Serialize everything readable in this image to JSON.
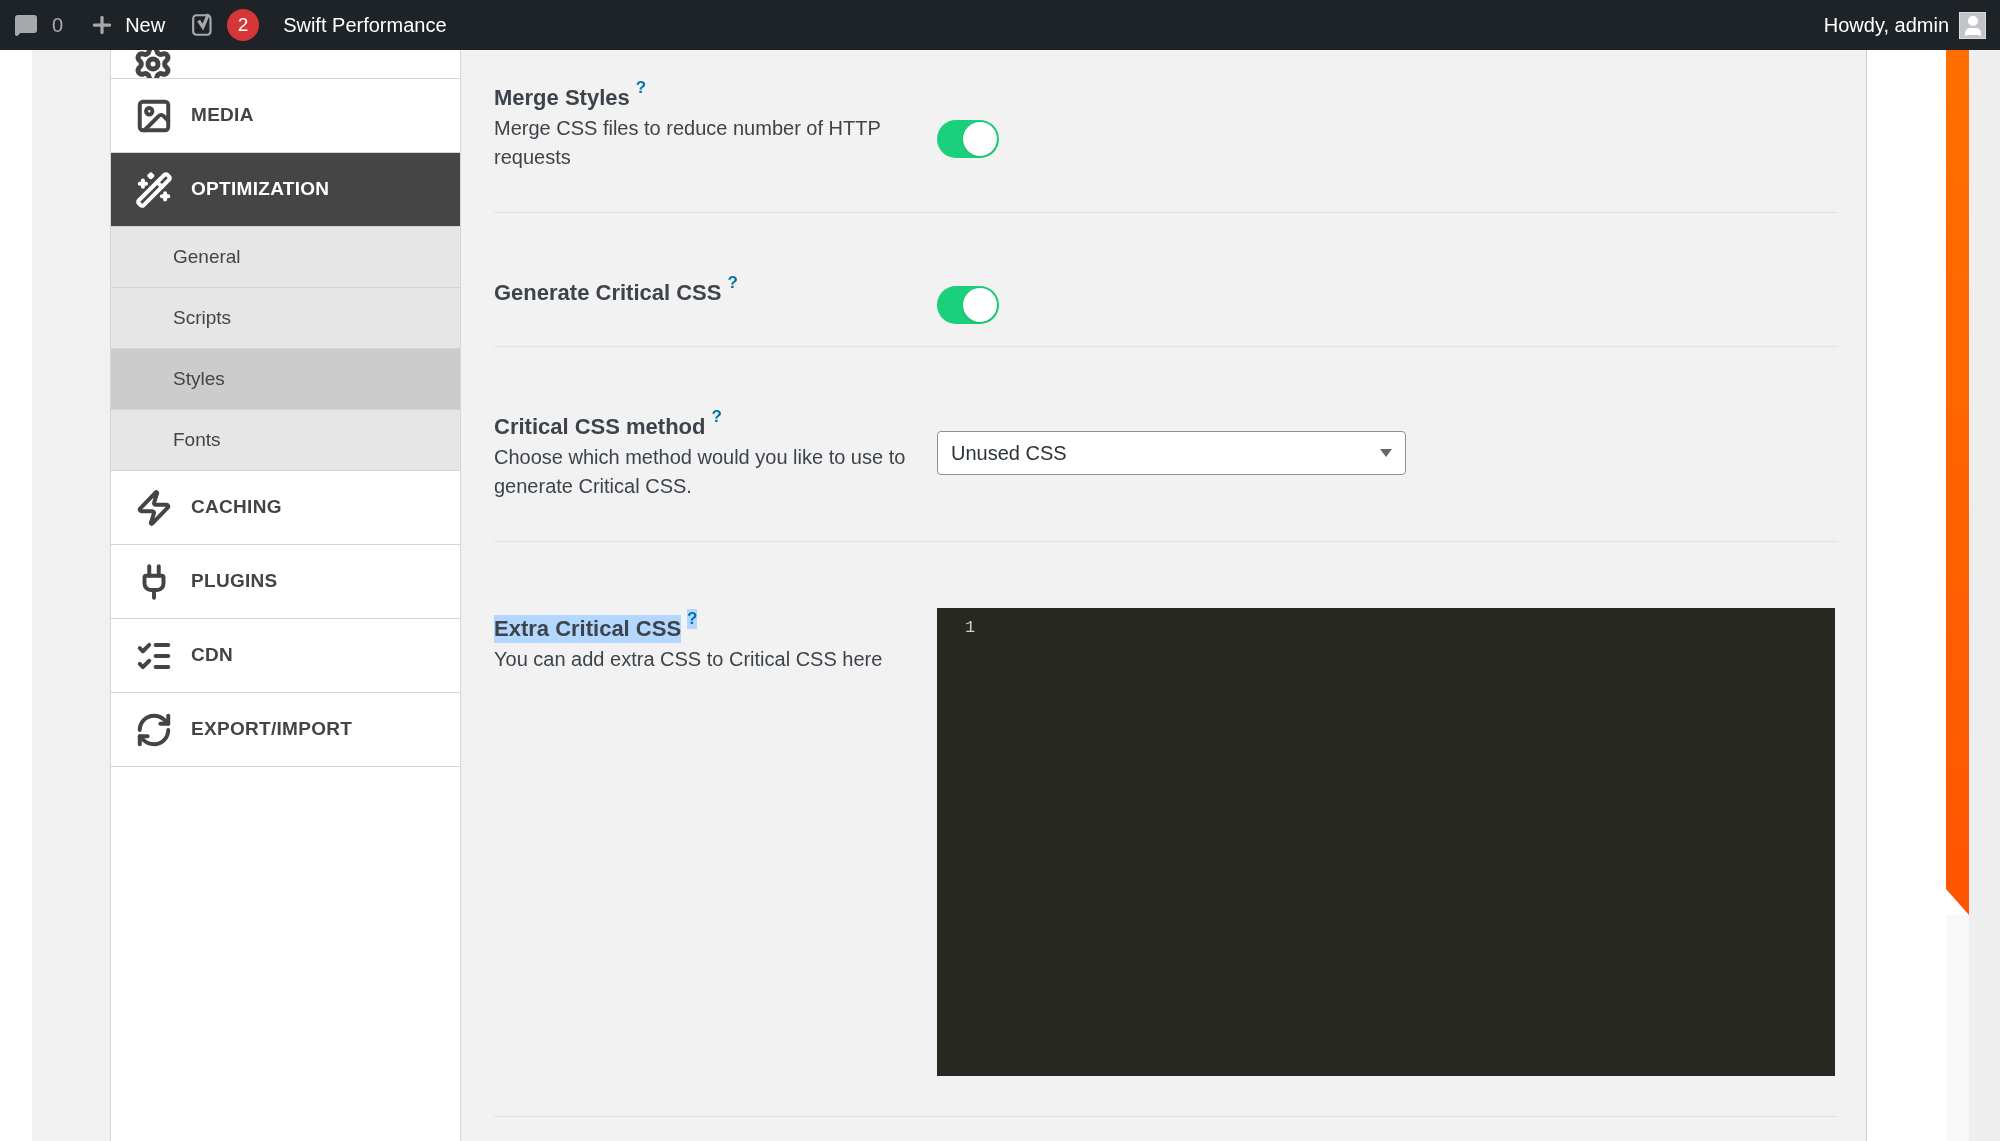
{
  "admin_bar": {
    "comments_count": "0",
    "new_label": "New",
    "notifications_count": "2",
    "site_name": "Swift Performance",
    "greeting": "Howdy, admin"
  },
  "sidebar": {
    "items": [
      {
        "label": "MEDIA",
        "selected": false
      },
      {
        "label": "OPTIMIZATION",
        "selected": true,
        "expanded": true,
        "children": [
          {
            "label": "General",
            "selected": false
          },
          {
            "label": "Scripts",
            "selected": false
          },
          {
            "label": "Styles",
            "selected": true
          },
          {
            "label": "Fonts",
            "selected": false
          }
        ]
      },
      {
        "label": "CACHING",
        "selected": false
      },
      {
        "label": "PLUGINS",
        "selected": false
      },
      {
        "label": "CDN",
        "selected": false
      },
      {
        "label": "EXPORT/IMPORT",
        "selected": false
      }
    ]
  },
  "settings": [
    {
      "kind": "toggle",
      "title": "Merge Styles",
      "help": "?",
      "description": "Merge CSS files to reduce number of HTTP requests",
      "on": true,
      "highlighted": false
    },
    {
      "kind": "toggle",
      "title": "Generate Critical CSS",
      "help": "?",
      "on": true,
      "highlighted": false
    },
    {
      "kind": "select",
      "title": "Critical CSS method",
      "help": "?",
      "description": "Choose which method would you like to use to generate Critical CSS.",
      "value": "Unused CSS",
      "highlighted": false
    },
    {
      "kind": "code",
      "title": "Extra Critical CSS",
      "help": "?",
      "description": "You can add extra CSS to Critical CSS here",
      "line_numbers": [
        "1"
      ],
      "highlighted": true
    }
  ]
}
